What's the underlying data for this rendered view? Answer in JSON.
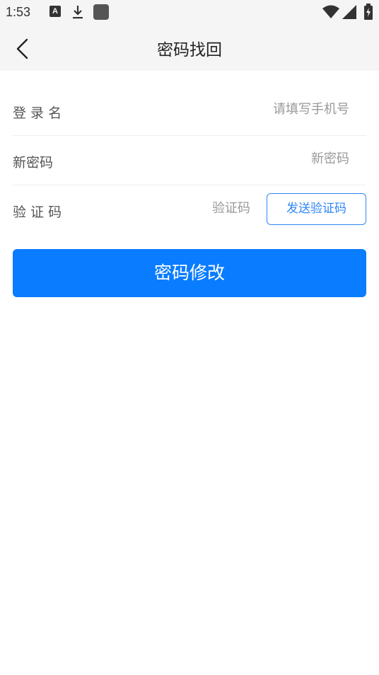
{
  "status_bar": {
    "time": "1:53",
    "icons": [
      "a-notification-icon",
      "download-icon",
      "app-square-icon",
      "wifi-icon",
      "signal-icon",
      "battery-icon"
    ]
  },
  "nav": {
    "back_icon": "chevron-left-icon",
    "title": "密码找回"
  },
  "form": {
    "login_name": {
      "label": "登 录 名",
      "placeholder": "请填写手机号",
      "value": ""
    },
    "new_password": {
      "label": "新密码",
      "placeholder": "新密码",
      "value": ""
    },
    "verification_code": {
      "label": "验 证 码",
      "placeholder": "验证码",
      "value": "",
      "send_button": "发送验证码"
    }
  },
  "submit": {
    "label": "密码修改"
  },
  "colors": {
    "accent": "#0a7cff",
    "outline_button": "#2f86f6",
    "header_bg": "#f5f5f5"
  }
}
